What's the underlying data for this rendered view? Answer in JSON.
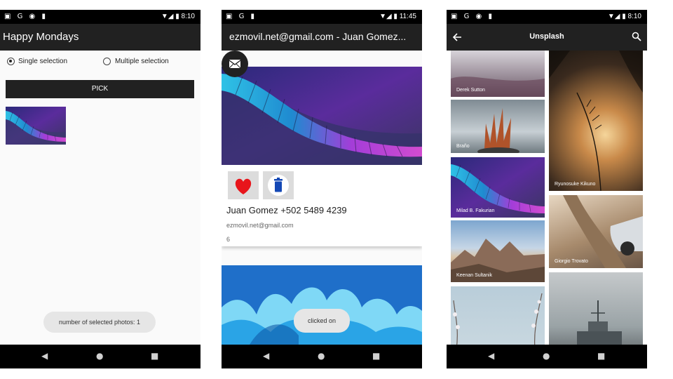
{
  "status_bars": [
    {
      "left": "▣ G ◉ ▮",
      "right": "▼◢ ▮ 8:10"
    },
    {
      "left": "▣ G ▮",
      "right": "▼◢ ▮ 11:45"
    },
    {
      "left": "▣ G ◉ ▮",
      "right": "▼◢ ▮ 8:10"
    }
  ],
  "nav": {
    "back": "◀",
    "home": "●",
    "recents": "■"
  },
  "screen1": {
    "title": "Happy Mondays",
    "single_label": "Single selection",
    "multiple_label": "Multiple selection",
    "selected_mode": "single",
    "pick_label": "PICK",
    "toast": "number of selected photos: 1"
  },
  "screen2": {
    "title": "ezmovil.net@gmail.com - Juan Gomez...",
    "name_phone": "Juan Gomez +502 5489 4239",
    "email": "ezmovil.net@gmail.com",
    "count": "6",
    "toast": "clicked on"
  },
  "screen3": {
    "title": "Unsplash",
    "photos_left": [
      "Derek Sutton",
      "Braño",
      "Milad B. Fakurian",
      "Keenan Sultanik",
      ""
    ],
    "photos_right": [
      "Ryunosuke Kikuno",
      "Giorgio Trovato",
      ""
    ]
  },
  "colors": {
    "appbar": "#212121",
    "status": "#000000",
    "favorite": "#e8151b",
    "delete": "#1448b5"
  }
}
